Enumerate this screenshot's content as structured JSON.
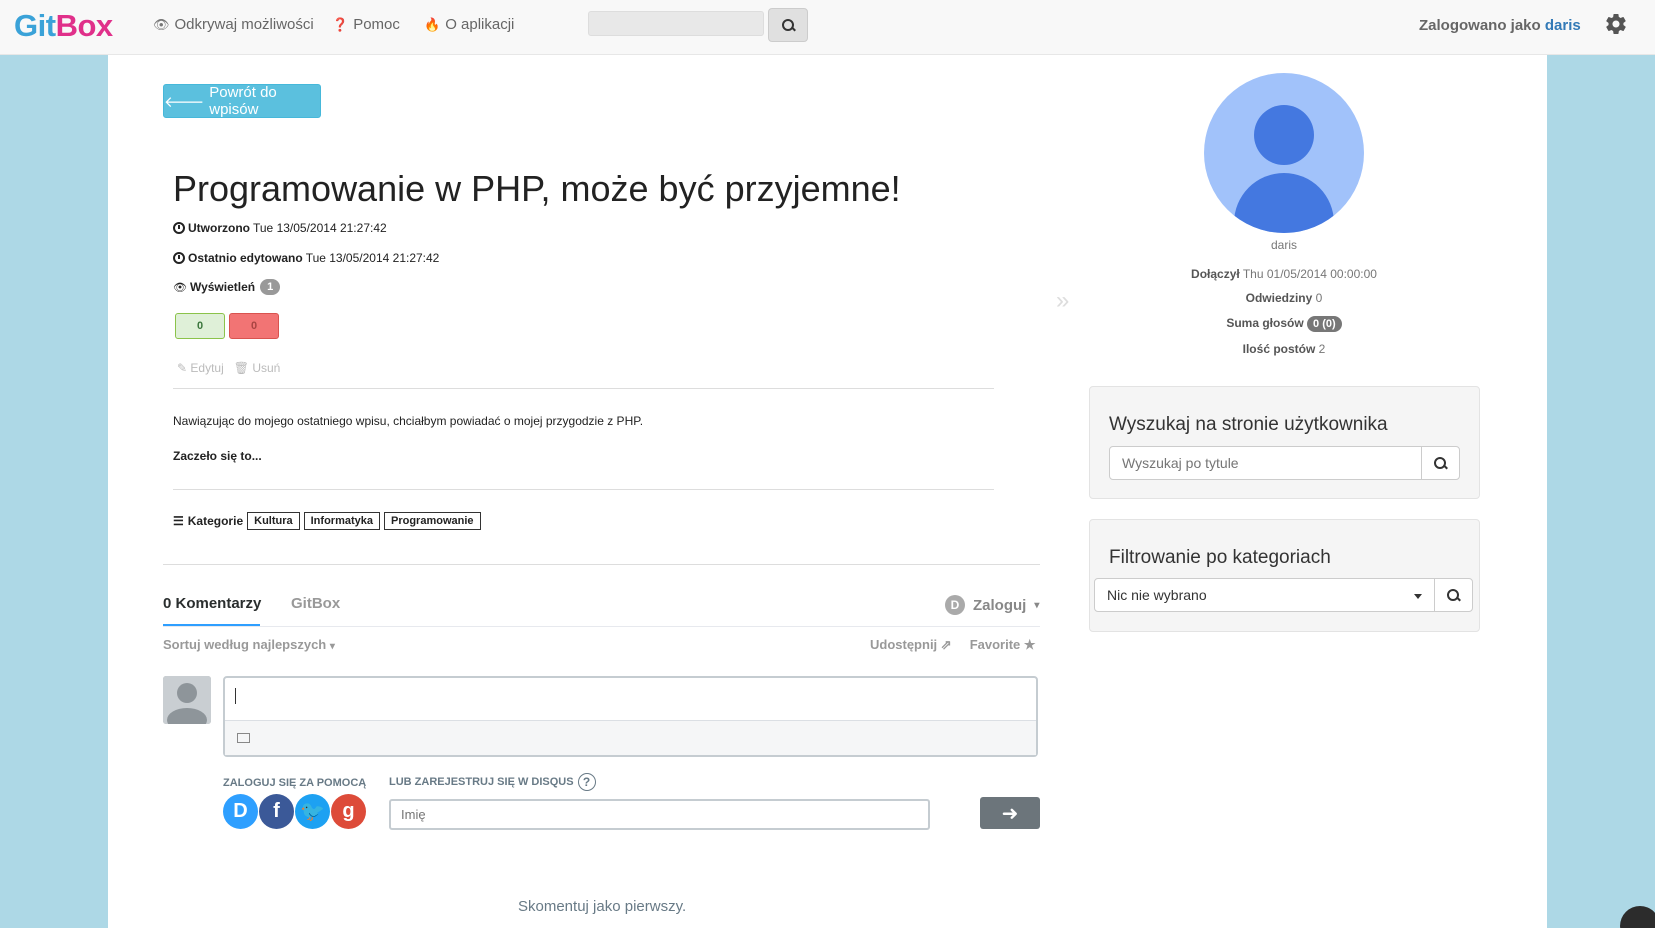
{
  "brand": {
    "part1": "Git",
    "part2": "Box"
  },
  "nav": {
    "links": [
      {
        "label": "Odkrywaj możliwości",
        "icon": "eye-icon"
      },
      {
        "label": "Pomoc",
        "icon": "question-circle-icon"
      },
      {
        "label": "O aplikacji",
        "icon": "fire-icon"
      }
    ],
    "search_value": "",
    "logged_prefix": "Zalogowano jako",
    "logged_user": "daris"
  },
  "post": {
    "back_label": "Powrót do wpisów",
    "title": "Programowanie w PHP, może być przyjemne!",
    "created_label": "Utworzono",
    "created_value": "Tue 13/05/2014 21:27:42",
    "edited_label": "Ostatnio edytowano",
    "edited_value": "Tue 13/05/2014 21:27:42",
    "views_label": "Wyświetleń",
    "views_value": "1",
    "votes_up": "0",
    "votes_down": "0",
    "edit_label": "Edytuj",
    "delete_label": "Usuń",
    "body": "Nawiązując do mojego ostatniego wpisu, chciałbym powiadać o mojej przygodzie z PHP.",
    "body_bold": "Zaczeło się to...",
    "categories_label": "Kategorie",
    "categories": [
      "Kultura",
      "Informatyka",
      "Programowanie"
    ]
  },
  "disqus": {
    "comments_tab": "0 Komentarzy",
    "site_tab": "GitBox",
    "login_label": "Zaloguj",
    "sort_label": "Sortuj według najlepszych",
    "share_label": "Udostępnij",
    "favorite_label": "Favorite",
    "login_with_label": "ZALOGUJ SIĘ ZA POMOCĄ",
    "register_label": "LUB ZAREJESTRUJ SIĘ W DISQUS",
    "name_placeholder": "Imię",
    "first_comment": "Skomentuj jako pierwszy.",
    "social": [
      {
        "name": "disqus",
        "glyph": "D",
        "color": "#2e9fff"
      },
      {
        "name": "facebook",
        "glyph": "f",
        "color": "#3b5998"
      },
      {
        "name": "twitter",
        "glyph": "t",
        "color": "#1da1f2"
      },
      {
        "name": "google",
        "glyph": "g",
        "color": "#dd4b39"
      }
    ]
  },
  "profile": {
    "username": "daris",
    "joined_label": "Dołączył",
    "joined_value": "Thu 01/05/2014 00:00:00",
    "visits_label": "Odwiedziny",
    "visits_value": "0",
    "votes_label": "Suma głosów",
    "votes_value": "0 (0)",
    "posts_label": "Ilość postów",
    "posts_value": "2"
  },
  "sidebar": {
    "search_title": "Wyszukaj na stronie użytkownika",
    "search_placeholder": "Wyszukaj po tytule",
    "filter_title": "Filtrowanie po kategoriach",
    "filter_selected": "Nic nie wybrano"
  }
}
